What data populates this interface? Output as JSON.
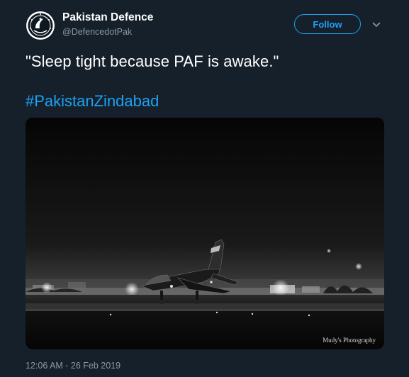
{
  "author": {
    "name": "Pakistan Defence",
    "handle": "@DefencedotPak",
    "avatar_icon": "emblem-avatar-icon"
  },
  "actions": {
    "follow_label": "Follow",
    "menu_icon": "chevron-down-icon"
  },
  "tweet": {
    "text": "\"Sleep tight because PAF is awake.\"",
    "hashtag": "#PakistanZindabad",
    "timestamp": "12:06 AM - 26 Feb 2019"
  },
  "media": {
    "description_icon": "fighter-jet-photo",
    "watermark": "Mudy's Photography"
  },
  "colors": {
    "background": "#15202b",
    "accent": "#1da1f2",
    "secondary_text": "#8899a6"
  }
}
